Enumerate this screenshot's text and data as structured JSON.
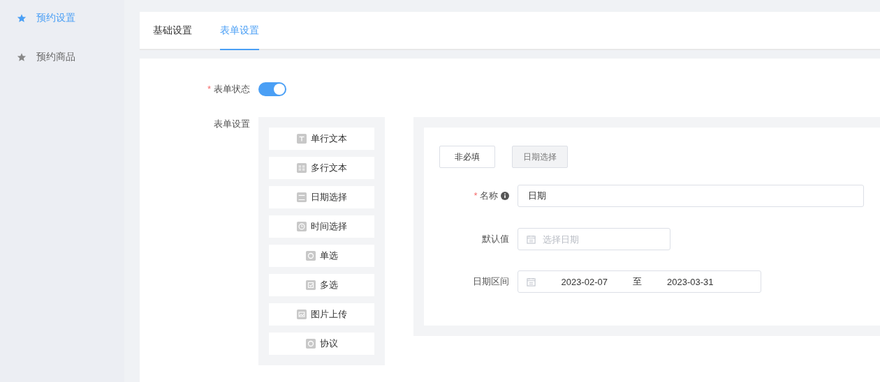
{
  "sidebar": {
    "items": [
      {
        "label": "预约设置",
        "selected": true
      },
      {
        "label": "预约商品",
        "selected": false
      }
    ]
  },
  "tabs": [
    {
      "label": "基础设置",
      "selected": false
    },
    {
      "label": "表单设置",
      "selected": true
    }
  ],
  "form_status": {
    "label": "表单状态",
    "required_mark": "*",
    "on": true
  },
  "form_settings": {
    "label": "表单设置",
    "palette": [
      {
        "label": "单行文本",
        "kind": "text"
      },
      {
        "label": "多行文本",
        "kind": "textarea"
      },
      {
        "label": "日期选择",
        "kind": "date"
      },
      {
        "label": "时间选择",
        "kind": "time"
      },
      {
        "label": "单选",
        "kind": "radio"
      },
      {
        "label": "多选",
        "kind": "checkbox"
      },
      {
        "label": "图片上传",
        "kind": "image"
      },
      {
        "label": "协议",
        "kind": "agreement"
      }
    ],
    "editor": {
      "required_button": "非必填",
      "type_button": "日期选择",
      "name": {
        "label": "名称",
        "required_mark": "*",
        "value": "日期"
      },
      "default": {
        "label": "默认值",
        "placeholder": "选择日期"
      },
      "range": {
        "label": "日期区间",
        "start": "2023-02-07",
        "separator": "至",
        "end": "2023-03-31"
      }
    }
  }
}
